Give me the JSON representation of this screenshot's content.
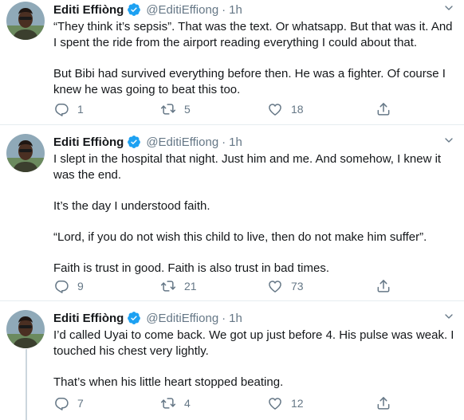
{
  "tweets": [
    {
      "name": "Editi Effiòng",
      "handle": "@EditiEffiong",
      "dot": "·",
      "time": "1h",
      "paragraphs": [
        "“They think it’s sepsis”. That was the text. Or whatsapp. But that was it. And I spent the ride from the airport reading everything I could about that.",
        "But Bibi had survived everything before then. He was a fighter. Of course I knew he was going to beat this too."
      ],
      "replies": "1",
      "retweets": "5",
      "likes": "18"
    },
    {
      "name": "Editi Effiòng",
      "handle": "@EditiEffiong",
      "dot": "·",
      "time": "1h",
      "paragraphs": [
        "I slept in the hospital that night. Just him and me. And somehow, I knew it was the end.",
        "It’s the day I understood faith.",
        "“Lord, if you do not wish this child to live, then do not make him suffer”.",
        "Faith is trust in good. Faith is also trust in bad times."
      ],
      "replies": "9",
      "retweets": "21",
      "likes": "73"
    },
    {
      "name": "Editi Effiòng",
      "handle": "@EditiEffiong",
      "dot": "·",
      "time": "1h",
      "paragraphs": [
        "I’d called Uyai to come back. We got up just before 4. His pulse was weak. I touched his chest very lightly.",
        "That’s when his little heart stopped beating."
      ],
      "replies": "7",
      "retweets": "4",
      "likes": "12"
    }
  ],
  "icons": {
    "verified": "verified-badge-icon",
    "reply": "reply-icon",
    "retweet": "retweet-icon",
    "like": "heart-icon",
    "share": "share-icon"
  },
  "colors": {
    "verified": "#1da1f2",
    "muted": "#657786",
    "text": "#14171a",
    "divider": "#e6ecf0"
  }
}
